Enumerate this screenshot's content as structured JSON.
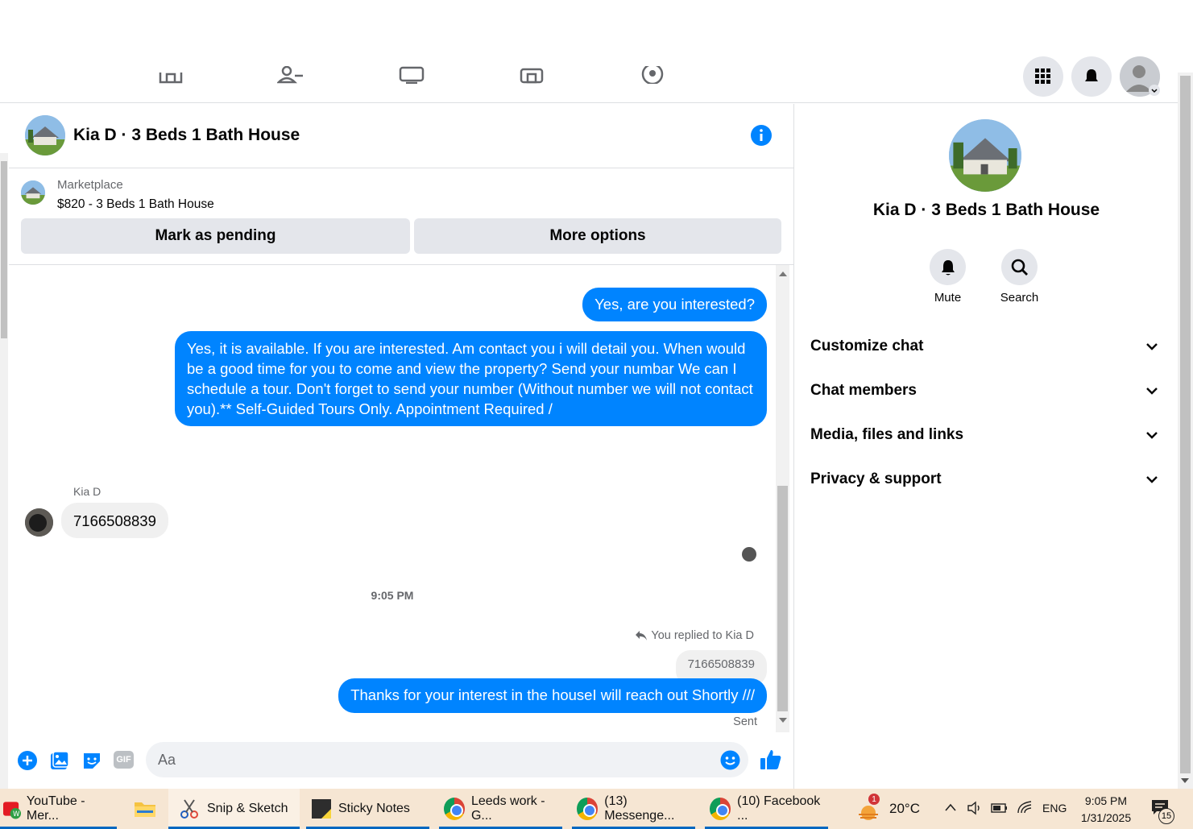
{
  "chat": {
    "title": "Kia D · 3 Beds 1 Bath House",
    "marketplace_label": "Marketplace",
    "listing": "$820 - 3 Beds 1 Bath House",
    "mark_pending": "Mark as pending",
    "more_options": "More options",
    "messages": {
      "out1": "Yes, are you interested?",
      "out2": "Yes, it is available. If you are interested.  Am contact you i will detail you.  When would be a good time for you to come and view the property? Send your numbar We can I schedule a tour.  Don't forget to send your number (Without number we will not contact you).** Self-Guided Tours Only. Appointment Required /",
      "sender": "Kia D",
      "in1": "7166508839",
      "time": "9:05 PM",
      "replied_to": "You replied to Kia D",
      "quoted": "7166508839",
      "out3": "Thanks for your interest in the houseI will reach out Shortly ///",
      "status": "Sent"
    },
    "composer_placeholder": "Aa",
    "gif_label": "GIF"
  },
  "details": {
    "title": "Kia D · 3 Beds 1 Bath House",
    "mute": "Mute",
    "search": "Search",
    "sections": [
      "Customize chat",
      "Chat members",
      "Media, files and links",
      "Privacy & support"
    ]
  },
  "taskbar": {
    "items": [
      "YouTube - Mer...",
      "Snip & Sketch",
      "Sticky Notes",
      "Leeds work - G...",
      "(13) Messenge...",
      "(10) Facebook ..."
    ],
    "weather_badge": "1",
    "temperature": "20°C",
    "language": "ENG",
    "time": "9:05 PM",
    "date": "1/31/2025",
    "notifications": "15"
  },
  "colors": {
    "accent": "#0084ff",
    "button_grey": "#e4e6eb",
    "taskbar": "#f6e6d3"
  }
}
